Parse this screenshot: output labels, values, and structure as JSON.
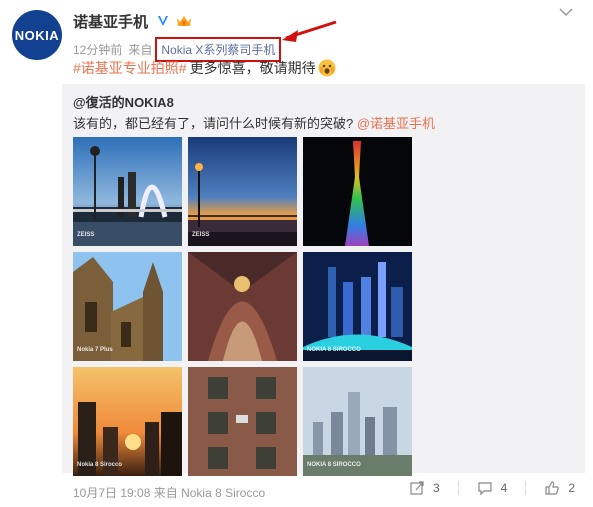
{
  "post": {
    "avatar_text": "NOKIA",
    "author": "诺基亚手机",
    "time": "12分钟前",
    "from_label": "来自",
    "source": "Nokia X系列蔡司手机",
    "topic": "#诺基亚专业拍照#",
    "text": "更多惊喜，敬请期待"
  },
  "repost": {
    "user": "@復活的NOKIA8",
    "text_prefix": "该有的，都已经有了，请问什么时候有新的突破?",
    "mention": "@诺基亚手机"
  },
  "images": [
    {
      "caption": "ZEISS",
      "scene": "bridge-dusk"
    },
    {
      "caption": "ZEISS",
      "scene": "river-sunset"
    },
    {
      "caption": "",
      "scene": "canton-tower"
    },
    {
      "caption": "Nokia 7 Plus",
      "scene": "cathedral-exterior"
    },
    {
      "caption": "",
      "scene": "cathedral-interior"
    },
    {
      "caption": "NOKIA 8 SIROCCO",
      "scene": "city-night"
    },
    {
      "caption": "Nokia 8 Sirocco",
      "scene": "sunset-buildings"
    },
    {
      "caption": "",
      "scene": "brick-building"
    },
    {
      "caption": "NOKIA 8 SIROCCO",
      "scene": "skyline-day"
    }
  ],
  "footer": {
    "date": "10月7日 19:08",
    "from_label": "来自",
    "device": "Nokia 8 Sirocco"
  },
  "actions": {
    "forward_count": "3",
    "comment_count": "4",
    "like_count": "2"
  },
  "colors": {
    "topic": "#eb7350",
    "highlight_box": "#d10f0f",
    "repost_bg": "#f2f2f5",
    "brand": "#124191"
  }
}
